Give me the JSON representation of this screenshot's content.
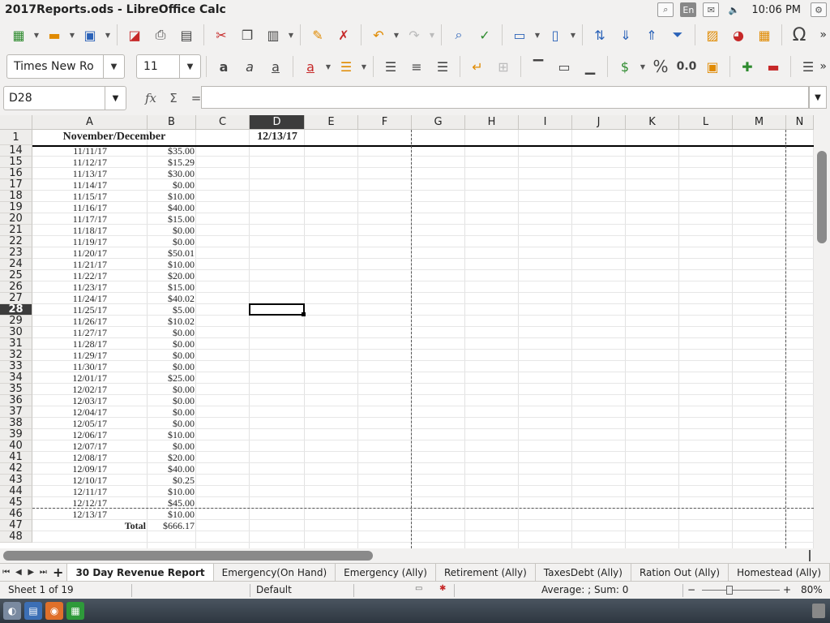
{
  "window": {
    "title": "2017Reports.ods - LibreOffice Calc"
  },
  "tray": {
    "lang": "En",
    "clock": "10:06 PM"
  },
  "font": {
    "name": "Times New Ro",
    "size": "11"
  },
  "formula_bar": {
    "cell_ref": "D28",
    "content": ""
  },
  "columns": [
    "A",
    "B",
    "C",
    "D",
    "E",
    "F",
    "G",
    "H",
    "I",
    "J",
    "K",
    "L",
    "M",
    "N"
  ],
  "selected_column": "D",
  "header_row": {
    "row": "1",
    "title": "November/December",
    "date": "12/13/17"
  },
  "rows": [
    {
      "row": "14",
      "date": "11/11/17",
      "amount": "$35.00"
    },
    {
      "row": "15",
      "date": "11/12/17",
      "amount": "$15.29"
    },
    {
      "row": "16",
      "date": "11/13/17",
      "amount": "$30.00"
    },
    {
      "row": "17",
      "date": "11/14/17",
      "amount": "$0.00"
    },
    {
      "row": "18",
      "date": "11/15/17",
      "amount": "$10.00"
    },
    {
      "row": "19",
      "date": "11/16/17",
      "amount": "$40.00"
    },
    {
      "row": "20",
      "date": "11/17/17",
      "amount": "$15.00"
    },
    {
      "row": "21",
      "date": "11/18/17",
      "amount": "$0.00"
    },
    {
      "row": "22",
      "date": "11/19/17",
      "amount": "$0.00"
    },
    {
      "row": "23",
      "date": "11/20/17",
      "amount": "$50.01"
    },
    {
      "row": "24",
      "date": "11/21/17",
      "amount": "$10.00"
    },
    {
      "row": "25",
      "date": "11/22/17",
      "amount": "$20.00"
    },
    {
      "row": "26",
      "date": "11/23/17",
      "amount": "$15.00"
    },
    {
      "row": "27",
      "date": "11/24/17",
      "amount": "$40.02"
    },
    {
      "row": "28",
      "date": "11/25/17",
      "amount": "$5.00"
    },
    {
      "row": "29",
      "date": "11/26/17",
      "amount": "$10.02"
    },
    {
      "row": "30",
      "date": "11/27/17",
      "amount": "$0.00"
    },
    {
      "row": "31",
      "date": "11/28/17",
      "amount": "$0.00"
    },
    {
      "row": "32",
      "date": "11/29/17",
      "amount": "$0.00"
    },
    {
      "row": "33",
      "date": "11/30/17",
      "amount": "$0.00"
    },
    {
      "row": "34",
      "date": "12/01/17",
      "amount": "$25.00"
    },
    {
      "row": "35",
      "date": "12/02/17",
      "amount": "$0.00"
    },
    {
      "row": "36",
      "date": "12/03/17",
      "amount": "$0.00"
    },
    {
      "row": "37",
      "date": "12/04/17",
      "amount": "$0.00"
    },
    {
      "row": "38",
      "date": "12/05/17",
      "amount": "$0.00"
    },
    {
      "row": "39",
      "date": "12/06/17",
      "amount": "$10.00"
    },
    {
      "row": "40",
      "date": "12/07/17",
      "amount": "$0.00"
    },
    {
      "row": "41",
      "date": "12/08/17",
      "amount": "$20.00"
    },
    {
      "row": "42",
      "date": "12/09/17",
      "amount": "$40.00"
    },
    {
      "row": "43",
      "date": "12/10/17",
      "amount": "$0.25"
    },
    {
      "row": "44",
      "date": "12/11/17",
      "amount": "$10.00"
    },
    {
      "row": "45",
      "date": "12/12/17",
      "amount": "$45.00"
    },
    {
      "row": "46",
      "date": "12/13/17",
      "amount": "$10.00"
    },
    {
      "row": "47",
      "date": "Total",
      "amount": "$666.17"
    },
    {
      "row": "48",
      "date": "",
      "amount": ""
    }
  ],
  "selected_row": "28",
  "sheet_tabs": [
    "30 Day Revenue Report",
    "Emergency(On Hand)",
    "Emergency (Ally)",
    "Retirement (Ally)",
    "TaxesDebt (Ally)",
    "Ration Out (Ally)",
    "Homestead (Ally)"
  ],
  "active_tab": "30 Day Revenue Report",
  "status": {
    "sheet": "Sheet 1 of 19",
    "style": "Default",
    "summary": "Average: ; Sum: 0",
    "zoom": "80%"
  },
  "icons": [
    "new-doc-icon",
    "open-folder-icon",
    "save-icon",
    "pdf-icon",
    "print-icon",
    "print-preview-icon",
    "cut-icon",
    "copy-icon",
    "paste-icon",
    "clone-format-icon",
    "clear-format-icon",
    "undo-icon",
    "redo-icon",
    "find-replace-icon",
    "spellcheck-icon",
    "row-icon",
    "column-icon",
    "sort-icon",
    "sort-ascending-icon",
    "sort-descending-icon",
    "autofilter-icon",
    "image-icon",
    "chart-icon",
    "pivot-table-icon",
    "special-character-icon"
  ]
}
